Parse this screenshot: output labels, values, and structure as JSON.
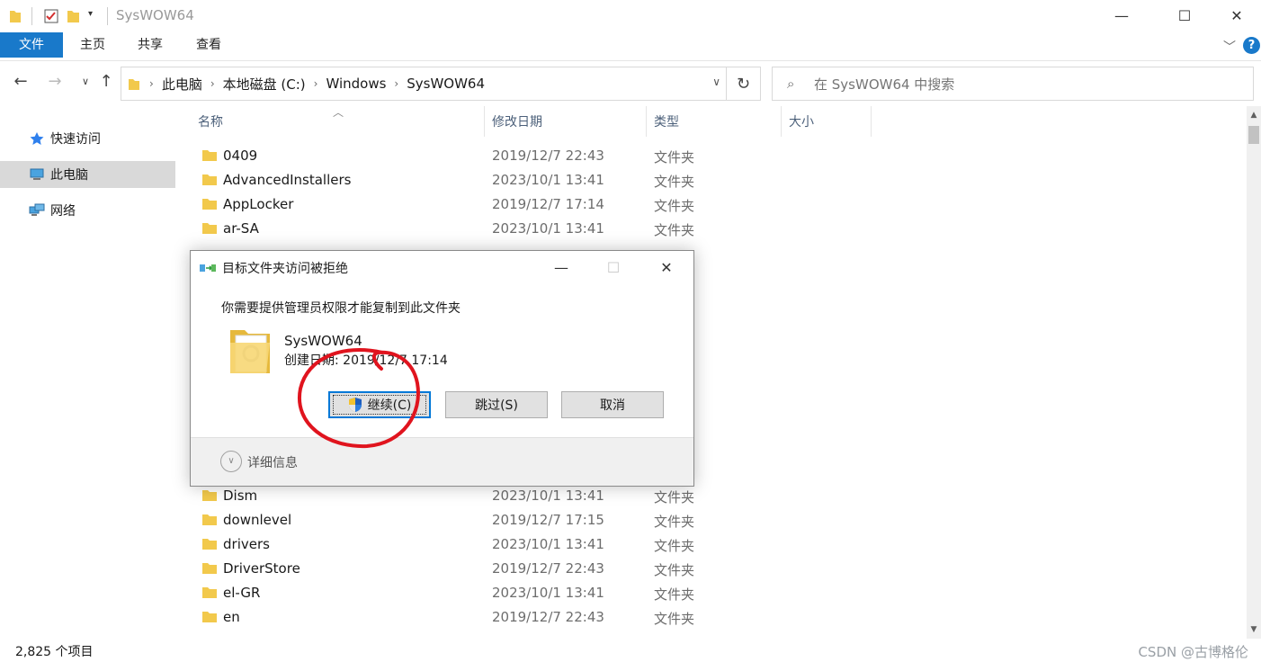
{
  "window": {
    "title": "SysWOW64",
    "controls": {
      "minimize": "—",
      "maximize": "☐",
      "close": "✕"
    }
  },
  "ribbon": {
    "tabs": [
      "文件",
      "主页",
      "共享",
      "查看"
    ],
    "help": "?"
  },
  "nav": {
    "breadcrumbs": [
      "此电脑",
      "本地磁盘 (C:)",
      "Windows",
      "SysWOW64"
    ],
    "search_placeholder": "在 SysWOW64 中搜索"
  },
  "sidebar": {
    "items": [
      {
        "label": "快速访问",
        "icon": "star-icon"
      },
      {
        "label": "此电脑",
        "icon": "computer-icon",
        "selected": true
      },
      {
        "label": "网络",
        "icon": "network-icon"
      }
    ]
  },
  "list": {
    "columns": {
      "name": "名称",
      "date": "修改日期",
      "type": "类型",
      "size": "大小"
    },
    "rows_top": [
      {
        "name": "0409",
        "date": "2019/12/7 22:43",
        "type": "文件夹"
      },
      {
        "name": "AdvancedInstallers",
        "date": "2023/10/1 13:41",
        "type": "文件夹"
      },
      {
        "name": "AppLocker",
        "date": "2019/12/7 17:14",
        "type": "文件夹"
      },
      {
        "name": "ar-SA",
        "date": "2023/10/1 13:41",
        "type": "文件夹"
      }
    ],
    "rows_bottom": [
      {
        "name": "Dism",
        "date": "2023/10/1 13:41",
        "type": "文件夹"
      },
      {
        "name": "downlevel",
        "date": "2019/12/7 17:15",
        "type": "文件夹"
      },
      {
        "name": "drivers",
        "date": "2023/10/1 13:41",
        "type": "文件夹"
      },
      {
        "name": "DriverStore",
        "date": "2019/12/7 22:43",
        "type": "文件夹"
      },
      {
        "name": "el-GR",
        "date": "2023/10/1 13:41",
        "type": "文件夹"
      },
      {
        "name": "en",
        "date": "2019/12/7 22:43",
        "type": "文件夹"
      }
    ]
  },
  "status": {
    "item_count": "2,825 个项目",
    "watermark": "CSDN @古博格伦"
  },
  "dialog": {
    "title": "目标文件夹访问被拒绝",
    "message": "你需要提供管理员权限才能复制到此文件夹",
    "folder_name": "SysWOW64",
    "folder_created": "创建日期: 2019/12/7 17:14",
    "buttons": {
      "continue": "继续(C)",
      "skip": "跳过(S)",
      "cancel": "取消"
    },
    "details": "详细信息"
  },
  "colors": {
    "accent": "#1979ca",
    "selection": "#d9d9d9",
    "annotation": "#e0141e",
    "folder": "#f2c94c"
  }
}
